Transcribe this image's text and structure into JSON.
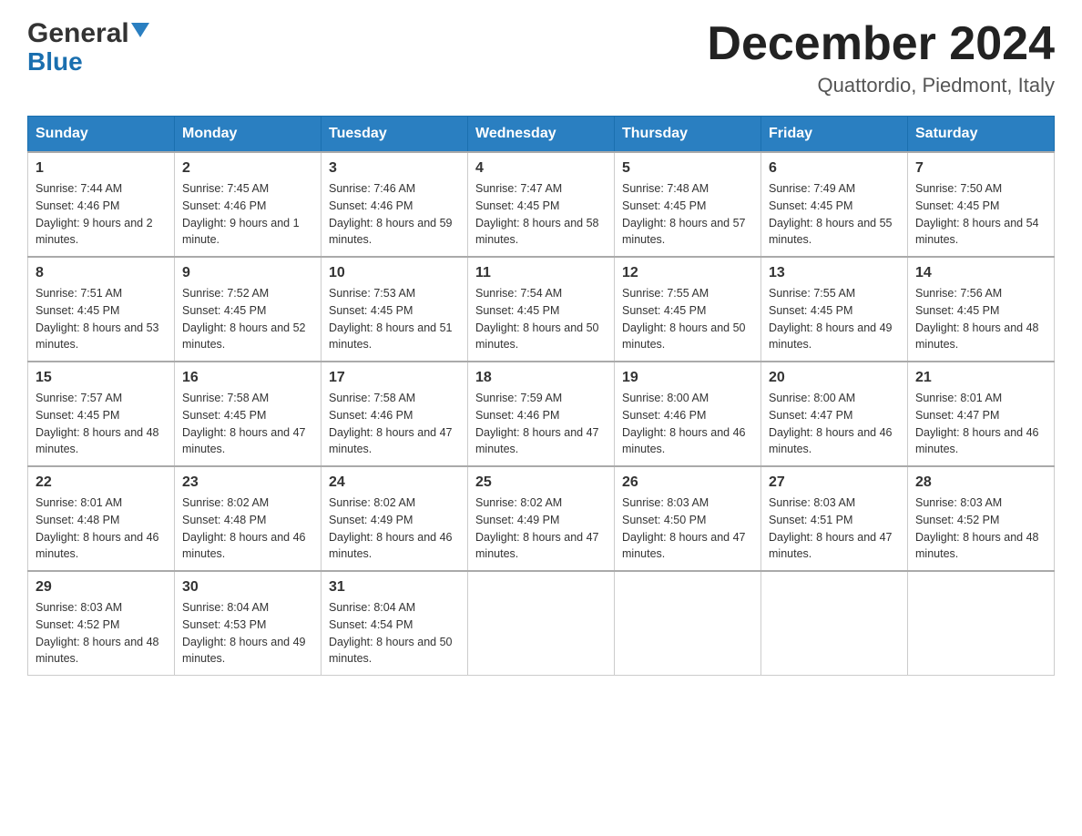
{
  "logo": {
    "general": "General",
    "blue": "Blue"
  },
  "header": {
    "month": "December 2024",
    "location": "Quattordio, Piedmont, Italy"
  },
  "days_of_week": [
    "Sunday",
    "Monday",
    "Tuesday",
    "Wednesday",
    "Thursday",
    "Friday",
    "Saturday"
  ],
  "weeks": [
    [
      {
        "day": "1",
        "sunrise": "Sunrise: 7:44 AM",
        "sunset": "Sunset: 4:46 PM",
        "daylight": "Daylight: 9 hours and 2 minutes."
      },
      {
        "day": "2",
        "sunrise": "Sunrise: 7:45 AM",
        "sunset": "Sunset: 4:46 PM",
        "daylight": "Daylight: 9 hours and 1 minute."
      },
      {
        "day": "3",
        "sunrise": "Sunrise: 7:46 AM",
        "sunset": "Sunset: 4:46 PM",
        "daylight": "Daylight: 8 hours and 59 minutes."
      },
      {
        "day": "4",
        "sunrise": "Sunrise: 7:47 AM",
        "sunset": "Sunset: 4:45 PM",
        "daylight": "Daylight: 8 hours and 58 minutes."
      },
      {
        "day": "5",
        "sunrise": "Sunrise: 7:48 AM",
        "sunset": "Sunset: 4:45 PM",
        "daylight": "Daylight: 8 hours and 57 minutes."
      },
      {
        "day": "6",
        "sunrise": "Sunrise: 7:49 AM",
        "sunset": "Sunset: 4:45 PM",
        "daylight": "Daylight: 8 hours and 55 minutes."
      },
      {
        "day": "7",
        "sunrise": "Sunrise: 7:50 AM",
        "sunset": "Sunset: 4:45 PM",
        "daylight": "Daylight: 8 hours and 54 minutes."
      }
    ],
    [
      {
        "day": "8",
        "sunrise": "Sunrise: 7:51 AM",
        "sunset": "Sunset: 4:45 PM",
        "daylight": "Daylight: 8 hours and 53 minutes."
      },
      {
        "day": "9",
        "sunrise": "Sunrise: 7:52 AM",
        "sunset": "Sunset: 4:45 PM",
        "daylight": "Daylight: 8 hours and 52 minutes."
      },
      {
        "day": "10",
        "sunrise": "Sunrise: 7:53 AM",
        "sunset": "Sunset: 4:45 PM",
        "daylight": "Daylight: 8 hours and 51 minutes."
      },
      {
        "day": "11",
        "sunrise": "Sunrise: 7:54 AM",
        "sunset": "Sunset: 4:45 PM",
        "daylight": "Daylight: 8 hours and 50 minutes."
      },
      {
        "day": "12",
        "sunrise": "Sunrise: 7:55 AM",
        "sunset": "Sunset: 4:45 PM",
        "daylight": "Daylight: 8 hours and 50 minutes."
      },
      {
        "day": "13",
        "sunrise": "Sunrise: 7:55 AM",
        "sunset": "Sunset: 4:45 PM",
        "daylight": "Daylight: 8 hours and 49 minutes."
      },
      {
        "day": "14",
        "sunrise": "Sunrise: 7:56 AM",
        "sunset": "Sunset: 4:45 PM",
        "daylight": "Daylight: 8 hours and 48 minutes."
      }
    ],
    [
      {
        "day": "15",
        "sunrise": "Sunrise: 7:57 AM",
        "sunset": "Sunset: 4:45 PM",
        "daylight": "Daylight: 8 hours and 48 minutes."
      },
      {
        "day": "16",
        "sunrise": "Sunrise: 7:58 AM",
        "sunset": "Sunset: 4:45 PM",
        "daylight": "Daylight: 8 hours and 47 minutes."
      },
      {
        "day": "17",
        "sunrise": "Sunrise: 7:58 AM",
        "sunset": "Sunset: 4:46 PM",
        "daylight": "Daylight: 8 hours and 47 minutes."
      },
      {
        "day": "18",
        "sunrise": "Sunrise: 7:59 AM",
        "sunset": "Sunset: 4:46 PM",
        "daylight": "Daylight: 8 hours and 47 minutes."
      },
      {
        "day": "19",
        "sunrise": "Sunrise: 8:00 AM",
        "sunset": "Sunset: 4:46 PM",
        "daylight": "Daylight: 8 hours and 46 minutes."
      },
      {
        "day": "20",
        "sunrise": "Sunrise: 8:00 AM",
        "sunset": "Sunset: 4:47 PM",
        "daylight": "Daylight: 8 hours and 46 minutes."
      },
      {
        "day": "21",
        "sunrise": "Sunrise: 8:01 AM",
        "sunset": "Sunset: 4:47 PM",
        "daylight": "Daylight: 8 hours and 46 minutes."
      }
    ],
    [
      {
        "day": "22",
        "sunrise": "Sunrise: 8:01 AM",
        "sunset": "Sunset: 4:48 PM",
        "daylight": "Daylight: 8 hours and 46 minutes."
      },
      {
        "day": "23",
        "sunrise": "Sunrise: 8:02 AM",
        "sunset": "Sunset: 4:48 PM",
        "daylight": "Daylight: 8 hours and 46 minutes."
      },
      {
        "day": "24",
        "sunrise": "Sunrise: 8:02 AM",
        "sunset": "Sunset: 4:49 PM",
        "daylight": "Daylight: 8 hours and 46 minutes."
      },
      {
        "day": "25",
        "sunrise": "Sunrise: 8:02 AM",
        "sunset": "Sunset: 4:49 PM",
        "daylight": "Daylight: 8 hours and 47 minutes."
      },
      {
        "day": "26",
        "sunrise": "Sunrise: 8:03 AM",
        "sunset": "Sunset: 4:50 PM",
        "daylight": "Daylight: 8 hours and 47 minutes."
      },
      {
        "day": "27",
        "sunrise": "Sunrise: 8:03 AM",
        "sunset": "Sunset: 4:51 PM",
        "daylight": "Daylight: 8 hours and 47 minutes."
      },
      {
        "day": "28",
        "sunrise": "Sunrise: 8:03 AM",
        "sunset": "Sunset: 4:52 PM",
        "daylight": "Daylight: 8 hours and 48 minutes."
      }
    ],
    [
      {
        "day": "29",
        "sunrise": "Sunrise: 8:03 AM",
        "sunset": "Sunset: 4:52 PM",
        "daylight": "Daylight: 8 hours and 48 minutes."
      },
      {
        "day": "30",
        "sunrise": "Sunrise: 8:04 AM",
        "sunset": "Sunset: 4:53 PM",
        "daylight": "Daylight: 8 hours and 49 minutes."
      },
      {
        "day": "31",
        "sunrise": "Sunrise: 8:04 AM",
        "sunset": "Sunset: 4:54 PM",
        "daylight": "Daylight: 8 hours and 50 minutes."
      },
      null,
      null,
      null,
      null
    ]
  ]
}
